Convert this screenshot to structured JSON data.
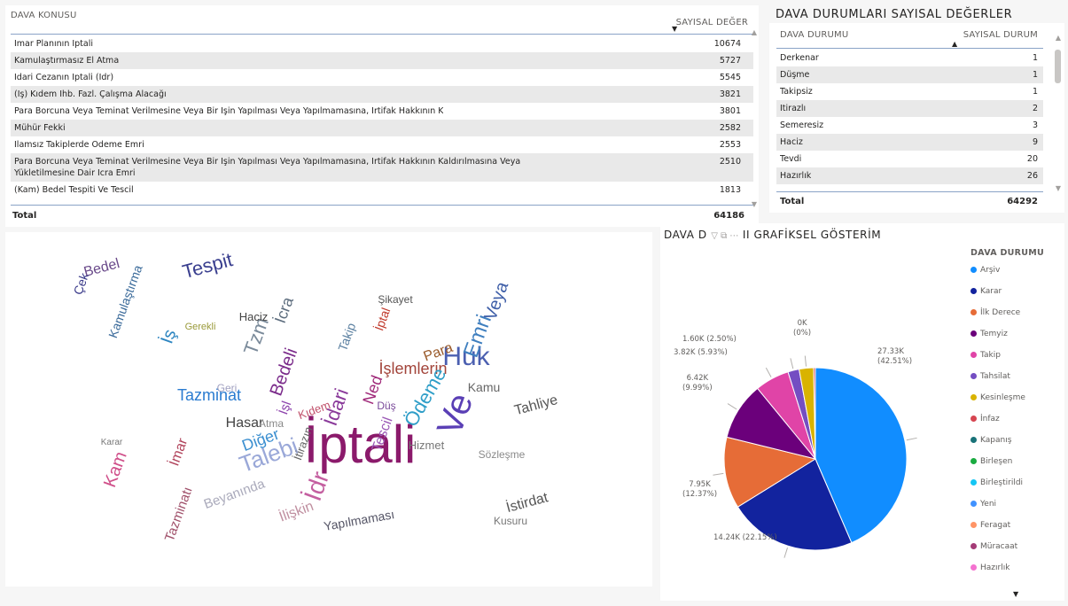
{
  "dava_konusu_table": {
    "col_subject": "DAVA KONUSU",
    "col_value": "SAYISAL DEĞER",
    "rows": [
      {
        "label": "İmar Planının İptali",
        "value": "10674"
      },
      {
        "label": "Kamulaştırmasız El Atma",
        "value": "5727"
      },
      {
        "label": "İdari Cezanın İptali (İdr)",
        "value": "5545"
      },
      {
        "label": "(İş) Kıdem İhb. Fazl. Çalışma Alacağı",
        "value": "3821"
      },
      {
        "label": "Para Borcuna Veya Teminat Verilmesine Veya Bir İşin Yapılması Veya Yapılmamasına, İrtifak Hakkının K",
        "value": "3801"
      },
      {
        "label": "Mühür Fekki",
        "value": "2582"
      },
      {
        "label": "İlamsız Takiplerde Ödeme Emri",
        "value": "2553"
      },
      {
        "label": "Para Borcuna Veya Teminat Verilmesine Veya Bir İşin Yapılması Veya Yapılmamasına, İrtifak Hakkının Kaldırılmasına Veya",
        "label2": "Yükletilmesine Dair İcra Emri",
        "value": "2510"
      },
      {
        "label": "(Kam) Bedel Tespiti Ve Tescil",
        "value": "1813"
      }
    ],
    "total_label": "Total",
    "total_value": "64186"
  },
  "dava_durum_table": {
    "title": "DAVA DURUMLARI SAYISAL DEĞERLER",
    "col_status": "DAVA DURUMU",
    "col_value": "SAYISAL DURUM",
    "rows": [
      {
        "label": "Derkenar",
        "value": "1"
      },
      {
        "label": "Düşme",
        "value": "1"
      },
      {
        "label": "Takipsiz",
        "value": "1"
      },
      {
        "label": "İtirazlı",
        "value": "2"
      },
      {
        "label": "Semeresiz",
        "value": "3"
      },
      {
        "label": "Haciz",
        "value": "9"
      },
      {
        "label": "Tevdi",
        "value": "20"
      },
      {
        "label": "Hazırlık",
        "value": "26"
      }
    ],
    "total_label": "Total",
    "total_value": "64292"
  },
  "word_cloud": {
    "words": [
      {
        "t": "İptali",
        "c": "#8b1a6b"
      },
      {
        "t": "Ve",
        "c": "#5a3fb5"
      },
      {
        "t": "Huk",
        "c": "#4b5fb0"
      },
      {
        "t": "Emri",
        "c": "#3f7fbf"
      },
      {
        "t": "İşlemlerin",
        "c": "#a2443a"
      },
      {
        "t": "Tespit",
        "c": "#3a3f8f"
      },
      {
        "t": "Tazminat",
        "c": "#2a7bd0"
      },
      {
        "t": "İdr",
        "c": "#c45fa0"
      },
      {
        "t": "Talebi",
        "c": "#9aa8d8"
      },
      {
        "t": "Ödeme",
        "c": "#2f9ec8"
      },
      {
        "t": "İdari",
        "c": "#8a3a9a"
      },
      {
        "t": "Bedeli",
        "c": "#7a2a8a"
      },
      {
        "t": "Diğer",
        "c": "#3b8fd0"
      },
      {
        "t": "Veya",
        "c": "#3f5fa8"
      },
      {
        "t": "Kam",
        "c": "#d0508a"
      },
      {
        "t": "Hasar",
        "c": "#444"
      },
      {
        "t": "İstirdat",
        "c": "#555"
      },
      {
        "t": "Tahliye",
        "c": "#555"
      },
      {
        "t": "Kamu",
        "c": "#666"
      },
      {
        "t": "Para",
        "c": "#9a5a2a"
      },
      {
        "t": "Tzm",
        "c": "#7a8a9a"
      },
      {
        "t": "İmar",
        "c": "#b0425a"
      },
      {
        "t": "İlişkin",
        "c": "#c08fa0"
      },
      {
        "t": "Yapılmaması",
        "c": "#556"
      },
      {
        "t": "Hizmet",
        "c": "#777"
      },
      {
        "t": "Sözleşme",
        "c": "#8a8a8a"
      },
      {
        "t": "Haciz",
        "c": "#444"
      },
      {
        "t": "Kıdem",
        "c": "#c0506a"
      },
      {
        "t": "Ned",
        "c": "#a02a7a"
      },
      {
        "t": "Tescil",
        "c": "#9b59b6"
      },
      {
        "t": "İş",
        "c": "#2e86c1"
      },
      {
        "t": "İşl",
        "c": "#8e44ad"
      },
      {
        "t": "İcra",
        "c": "#5d6d7e"
      },
      {
        "t": "İptal",
        "c": "#c0392b"
      },
      {
        "t": "Beyanında",
        "c": "#aab"
      },
      {
        "t": "İtirazın",
        "c": "#666"
      },
      {
        "t": "Takip",
        "c": "#5a7fa0"
      },
      {
        "t": "Düş",
        "c": "#7a4a9a"
      },
      {
        "t": "Bedel",
        "c": "#6a4a8a"
      },
      {
        "t": "Kamulaştırma",
        "c": "#3a6a9a"
      },
      {
        "t": "Şikayet",
        "c": "#555"
      },
      {
        "t": "Tazminatı",
        "c": "#a0506a"
      },
      {
        "t": "Kusuru",
        "c": "#777"
      },
      {
        "t": "Gerekli",
        "c": "#9a9a3a"
      },
      {
        "t": "Atma",
        "c": "#888"
      },
      {
        "t": "Geri",
        "c": "#a0a0c0"
      },
      {
        "t": "Karar",
        "c": "#777"
      },
      {
        "t": "Çek",
        "c": "#3a3a8a"
      }
    ]
  },
  "pie_chart": {
    "title_prefix": "DAVA D",
    "title_suffix": "II GRAFİKSEL GÖSTERİM",
    "legend_title": "DAVA DURUMU",
    "legend": [
      {
        "name": "Arşiv",
        "color": "#118dff"
      },
      {
        "name": "Karar",
        "color": "#12239e"
      },
      {
        "name": "İlk Derece",
        "color": "#e66c37"
      },
      {
        "name": "Temyiz",
        "color": "#6b007b"
      },
      {
        "name": "Takip",
        "color": "#e044a7"
      },
      {
        "name": "Tahsilat",
        "color": "#744ec2"
      },
      {
        "name": "Kesinleşme",
        "color": "#d9b300"
      },
      {
        "name": "İnfaz",
        "color": "#d64550"
      },
      {
        "name": "Kapanış",
        "color": "#197278"
      },
      {
        "name": "Birleşen",
        "color": "#1aab40"
      },
      {
        "name": "Birleştirildi",
        "color": "#15c6f4"
      },
      {
        "name": "Yeni",
        "color": "#4092ff"
      },
      {
        "name": "Feragat",
        "color": "#ff9466"
      },
      {
        "name": "Müracaat",
        "color": "#a43b76"
      },
      {
        "name": "Hazırlık",
        "color": "#f472d0"
      }
    ],
    "labels": [
      {
        "line1": "27.33K",
        "line2": "(42.51%)"
      },
      {
        "line1": "14.24K (22.15%)",
        "line2": ""
      },
      {
        "line1": "7.95K",
        "line2": "(12.37%)"
      },
      {
        "line1": "6.42K",
        "line2": "(9.99%)"
      },
      {
        "line1": "3.82K (5.93%)",
        "line2": ""
      },
      {
        "line1": "1.60K (2.50%)",
        "line2": ""
      },
      {
        "line1": "0K",
        "line2": "(0%)"
      }
    ]
  },
  "chart_data": {
    "type": "pie",
    "title": "DAVA D II GRAFİKSEL GÖSTERİM",
    "categories": [
      "Arşiv",
      "Karar",
      "İlk Derece",
      "Temyiz",
      "Takip",
      "Tahsilat",
      "Kesinleşme",
      "İnfaz"
    ],
    "values": [
      27330,
      14240,
      7950,
      6420,
      3820,
      1250,
      1600,
      200
    ],
    "legend_position": "right"
  }
}
